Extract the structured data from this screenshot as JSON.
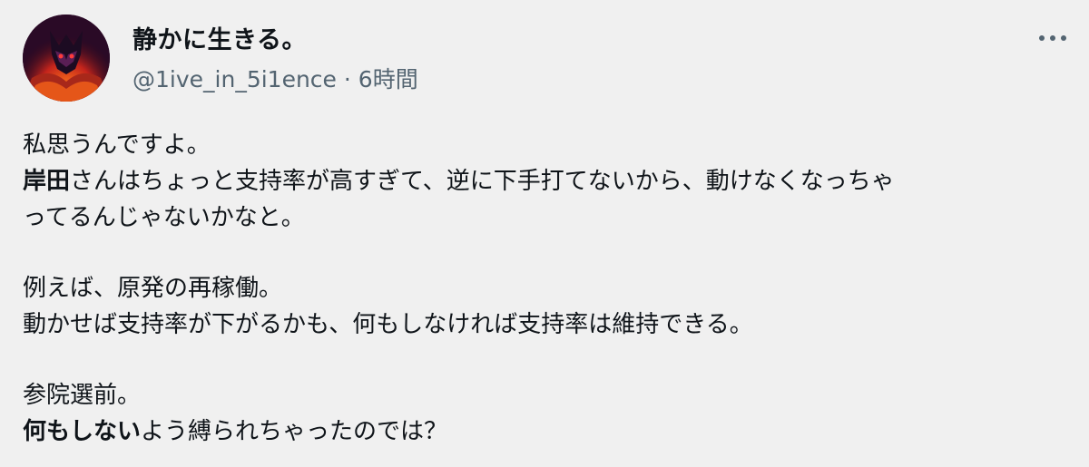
{
  "tweet": {
    "display_name": "静かに生きる。",
    "handle": "@1ive_in_5i1ence",
    "separator": "·",
    "time": "6時間",
    "body": {
      "p1_l1": "私思うんですよ。",
      "p1_l2_bold": "岸田",
      "p1_l2_rest": "さんはちょっと支持率が高すぎて、逆に下手打てないから、動けなくなっちゃ",
      "p1_l3": "ってるんじゃないかなと。",
      "p2_l1": "例えば、原発の再稼働。",
      "p2_l2": "動かせば支持率が下がるかも、何もしなければ支持率は維持できる。",
      "p3_l1": "参院選前。",
      "p3_l2_bold": "何もしない",
      "p3_l2_rest": "よう縛られちゃったのでは？"
    }
  },
  "icons": {
    "avatar": "avatar-image",
    "more": "more-options-icon"
  },
  "colors": {
    "background": "#f0f0f0",
    "text_primary": "#0f1419",
    "text_secondary": "#536471"
  }
}
